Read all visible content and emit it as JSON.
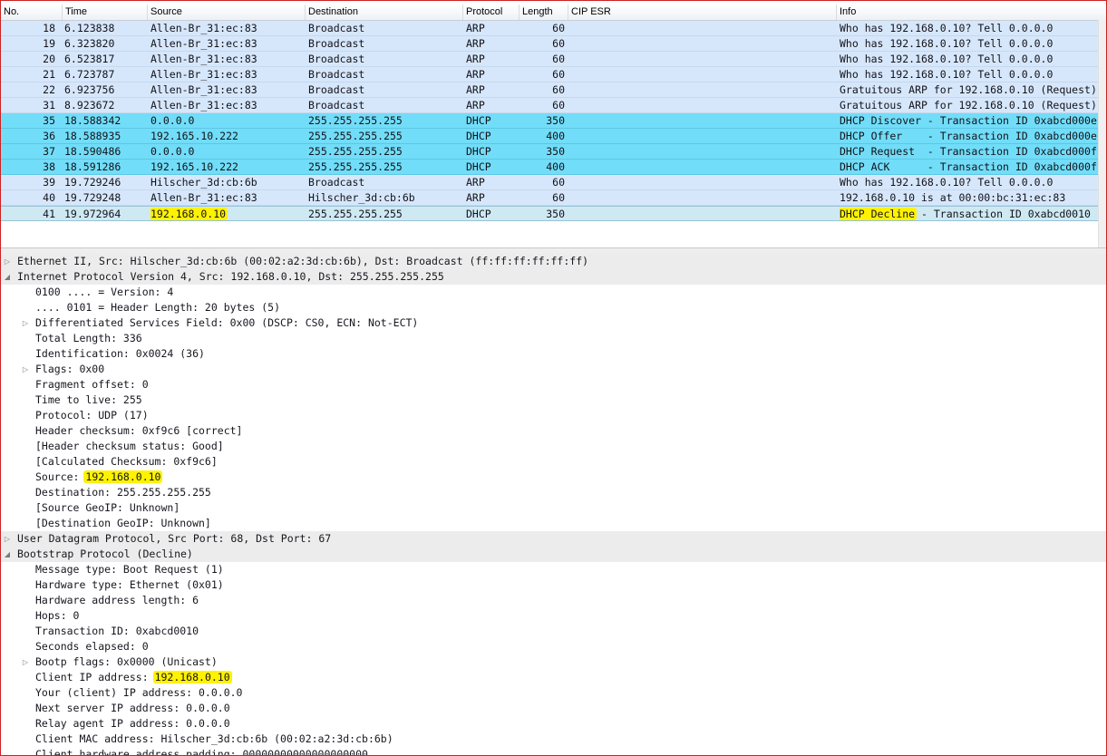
{
  "packet_list": {
    "columns": [
      "No.",
      "Time",
      "Source",
      "Destination",
      "Protocol",
      "Length",
      "CIP ESR",
      "Info"
    ],
    "rows": [
      {
        "no": "18",
        "time": "6.123838",
        "src": "Allen-Br_31:ec:83",
        "dst": "Broadcast",
        "proto": "ARP",
        "len": "60",
        "cip": "",
        "info": "Who has 192.168.0.10? Tell 0.0.0.0",
        "kind": "arp"
      },
      {
        "no": "19",
        "time": "6.323820",
        "src": "Allen-Br_31:ec:83",
        "dst": "Broadcast",
        "proto": "ARP",
        "len": "60",
        "cip": "",
        "info": "Who has 192.168.0.10? Tell 0.0.0.0",
        "kind": "arp"
      },
      {
        "no": "20",
        "time": "6.523817",
        "src": "Allen-Br_31:ec:83",
        "dst": "Broadcast",
        "proto": "ARP",
        "len": "60",
        "cip": "",
        "info": "Who has 192.168.0.10? Tell 0.0.0.0",
        "kind": "arp"
      },
      {
        "no": "21",
        "time": "6.723787",
        "src": "Allen-Br_31:ec:83",
        "dst": "Broadcast",
        "proto": "ARP",
        "len": "60",
        "cip": "",
        "info": "Who has 192.168.0.10? Tell 0.0.0.0",
        "kind": "arp"
      },
      {
        "no": "22",
        "time": "6.923756",
        "src": "Allen-Br_31:ec:83",
        "dst": "Broadcast",
        "proto": "ARP",
        "len": "60",
        "cip": "",
        "info": "Gratuitous ARP for 192.168.0.10 (Request)",
        "kind": "arp"
      },
      {
        "no": "31",
        "time": "8.923672",
        "src": "Allen-Br_31:ec:83",
        "dst": "Broadcast",
        "proto": "ARP",
        "len": "60",
        "cip": "",
        "info": "Gratuitous ARP for 192.168.0.10 (Request)",
        "kind": "arp"
      },
      {
        "no": "35",
        "time": "18.588342",
        "src": "0.0.0.0",
        "dst": "255.255.255.255",
        "proto": "DHCP",
        "len": "350",
        "cip": "",
        "info": "DHCP Discover - Transaction ID 0xabcd000e",
        "kind": "dhcp"
      },
      {
        "no": "36",
        "time": "18.588935",
        "src": "192.165.10.222",
        "dst": "255.255.255.255",
        "proto": "DHCP",
        "len": "400",
        "cip": "",
        "info": "DHCP Offer    - Transaction ID 0xabcd000e",
        "kind": "dhcp"
      },
      {
        "no": "37",
        "time": "18.590486",
        "src": "0.0.0.0",
        "dst": "255.255.255.255",
        "proto": "DHCP",
        "len": "350",
        "cip": "",
        "info": "DHCP Request  - Transaction ID 0xabcd000f",
        "kind": "dhcp"
      },
      {
        "no": "38",
        "time": "18.591286",
        "src": "192.165.10.222",
        "dst": "255.255.255.255",
        "proto": "DHCP",
        "len": "400",
        "cip": "",
        "info": "DHCP ACK      - Transaction ID 0xabcd000f",
        "kind": "dhcp"
      },
      {
        "no": "39",
        "time": "19.729246",
        "src": "Hilscher_3d:cb:6b",
        "dst": "Broadcast",
        "proto": "ARP",
        "len": "60",
        "cip": "",
        "info": "Who has 192.168.0.10? Tell 0.0.0.0",
        "kind": "arp"
      },
      {
        "no": "40",
        "time": "19.729248",
        "src": "Allen-Br_31:ec:83",
        "dst": "Hilscher_3d:cb:6b",
        "proto": "ARP",
        "len": "60",
        "cip": "",
        "info": "192.168.0.10 is at 00:00:bc:31:ec:83",
        "kind": "arp"
      },
      {
        "no": "41",
        "time": "19.972964",
        "src": "192.168.0.10",
        "dst": "255.255.255.255",
        "proto": "DHCP",
        "len": "350",
        "cip": "",
        "info_hl": "DHCP Decline",
        "info_rest": " - Transaction ID 0xabcd0010",
        "kind": "sel"
      }
    ]
  },
  "details": [
    {
      "level": 0,
      "toggle": "collapsed",
      "text": "Ethernet II, Src: Hilscher_3d:cb:6b (00:02:a2:3d:cb:6b), Dst: Broadcast (ff:ff:ff:ff:ff:ff)"
    },
    {
      "level": 0,
      "toggle": "expanded",
      "text": "Internet Protocol Version 4, Src: 192.168.0.10, Dst: 255.255.255.255"
    },
    {
      "level": 1,
      "toggle": "",
      "text": "0100 .... = Version: 4"
    },
    {
      "level": 1,
      "toggle": "",
      "text": ".... 0101 = Header Length: 20 bytes (5)"
    },
    {
      "level": 1,
      "toggle": "collapsed",
      "text": "Differentiated Services Field: 0x00 (DSCP: CS0, ECN: Not-ECT)"
    },
    {
      "level": 1,
      "toggle": "",
      "text": "Total Length: 336"
    },
    {
      "level": 1,
      "toggle": "",
      "text": "Identification: 0x0024 (36)"
    },
    {
      "level": 1,
      "toggle": "collapsed",
      "text": "Flags: 0x00"
    },
    {
      "level": 1,
      "toggle": "",
      "text": "Fragment offset: 0"
    },
    {
      "level": 1,
      "toggle": "",
      "text": "Time to live: 255"
    },
    {
      "level": 1,
      "toggle": "",
      "text": "Protocol: UDP (17)"
    },
    {
      "level": 1,
      "toggle": "",
      "text": "Header checksum: 0xf9c6 [correct]"
    },
    {
      "level": 1,
      "toggle": "",
      "text": "[Header checksum status: Good]"
    },
    {
      "level": 1,
      "toggle": "",
      "text": "[Calculated Checksum: 0xf9c6]"
    },
    {
      "level": 1,
      "toggle": "",
      "text": "Source: ",
      "hl": "192.168.0.10"
    },
    {
      "level": 1,
      "toggle": "",
      "text": "Destination: 255.255.255.255"
    },
    {
      "level": 1,
      "toggle": "",
      "text": "[Source GeoIP: Unknown]"
    },
    {
      "level": 1,
      "toggle": "",
      "text": "[Destination GeoIP: Unknown]"
    },
    {
      "level": 0,
      "toggle": "collapsed",
      "text": "User Datagram Protocol, Src Port: 68, Dst Port: 67"
    },
    {
      "level": 0,
      "toggle": "expanded",
      "text": "Bootstrap Protocol (Decline)"
    },
    {
      "level": 1,
      "toggle": "",
      "text": "Message type: Boot Request (1)"
    },
    {
      "level": 1,
      "toggle": "",
      "text": "Hardware type: Ethernet (0x01)"
    },
    {
      "level": 1,
      "toggle": "",
      "text": "Hardware address length: 6"
    },
    {
      "level": 1,
      "toggle": "",
      "text": "Hops: 0"
    },
    {
      "level": 1,
      "toggle": "",
      "text": "Transaction ID: 0xabcd0010"
    },
    {
      "level": 1,
      "toggle": "",
      "text": "Seconds elapsed: 0"
    },
    {
      "level": 1,
      "toggle": "collapsed",
      "text": "Bootp flags: 0x0000 (Unicast)"
    },
    {
      "level": 1,
      "toggle": "",
      "text": "Client IP address: ",
      "hl": "192.168.0.10"
    },
    {
      "level": 1,
      "toggle": "",
      "text": "Your (client) IP address: 0.0.0.0"
    },
    {
      "level": 1,
      "toggle": "",
      "text": "Next server IP address: 0.0.0.0"
    },
    {
      "level": 1,
      "toggle": "",
      "text": "Relay agent IP address: 0.0.0.0"
    },
    {
      "level": 1,
      "toggle": "",
      "text": "Client MAC address: Hilscher_3d:cb:6b (00:02:a2:3d:cb:6b)"
    },
    {
      "level": 1,
      "toggle": "",
      "text": "Client hardware address padding: 00000000000000000000"
    }
  ],
  "colors": {
    "arp_row": "#d7e7fb",
    "dhcp_row": "#72ddf8",
    "selected_row": "#cfe9f3",
    "highlight": "#fff200",
    "frame_border": "#cc2222"
  },
  "icons": {
    "collapsed": "triangle-right-icon",
    "expanded": "triangle-down-icon"
  }
}
